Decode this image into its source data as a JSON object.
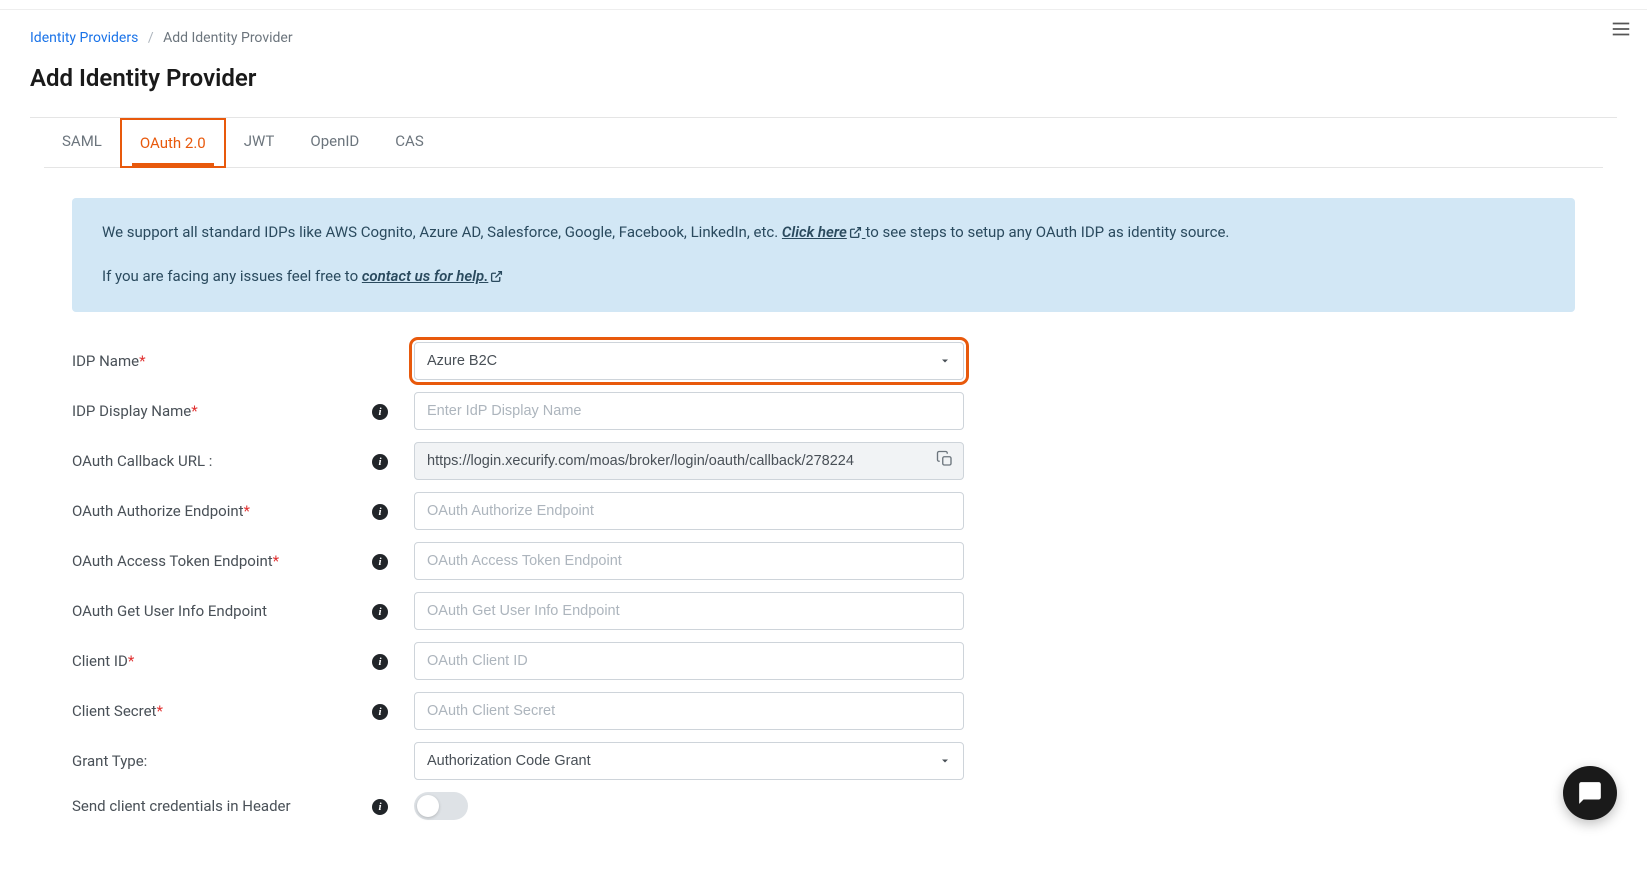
{
  "breadcrumb": {
    "root": "Identity Providers",
    "current": "Add Identity Provider"
  },
  "page_title": "Add Identity Provider",
  "tabs": [
    {
      "label": "SAML",
      "active": false
    },
    {
      "label": "OAuth 2.0",
      "active": true
    },
    {
      "label": "JWT",
      "active": false
    },
    {
      "label": "OpenID",
      "active": false
    },
    {
      "label": "CAS",
      "active": false
    }
  ],
  "info_box": {
    "line1_pre": "We support all standard IDPs like AWS Cognito, Azure AD, Salesforce, Google, Facebook, LinkedIn, etc. ",
    "line1_link": "Click here",
    "line1_post": " to see steps to setup any OAuth IDP as identity source.",
    "line2_pre": "If you are facing any issues feel free to ",
    "line2_link": "contact us for help."
  },
  "form": {
    "idp_name": {
      "label": "IDP Name",
      "required": true,
      "value": "Azure B2C"
    },
    "idp_display_name": {
      "label": "IDP Display Name",
      "required": true,
      "placeholder": "Enter IdP Display Name",
      "value": ""
    },
    "callback_url": {
      "label": "OAuth Callback URL :",
      "value": "https://login.xecurify.com/moas/broker/login/oauth/callback/278224"
    },
    "authorize_endpoint": {
      "label": "OAuth Authorize Endpoint",
      "required": true,
      "placeholder": "OAuth Authorize Endpoint",
      "value": ""
    },
    "token_endpoint": {
      "label": "OAuth Access Token Endpoint",
      "required": true,
      "placeholder": "OAuth Access Token Endpoint",
      "value": ""
    },
    "userinfo_endpoint": {
      "label": "OAuth Get User Info Endpoint",
      "placeholder": "OAuth Get User Info Endpoint",
      "value": ""
    },
    "client_id": {
      "label": "Client ID",
      "required": true,
      "placeholder": "OAuth Client ID",
      "value": ""
    },
    "client_secret": {
      "label": "Client Secret",
      "required": true,
      "placeholder": "OAuth Client Secret",
      "value": ""
    },
    "grant_type": {
      "label": "Grant Type:",
      "value": "Authorization Code Grant"
    },
    "send_header": {
      "label": "Send client credentials in Header",
      "value": false
    }
  }
}
